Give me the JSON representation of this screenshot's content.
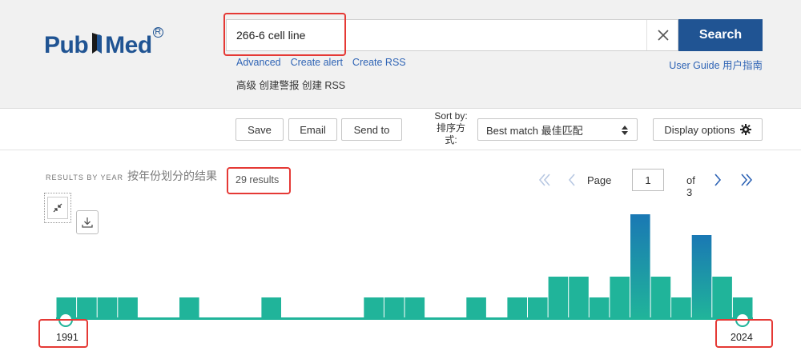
{
  "brand": {
    "logo_pub": "Pub",
    "logo_med": "Med",
    "registered": "R"
  },
  "search": {
    "query": "266-6 cell line",
    "button_label": "Search",
    "links": [
      "Advanced",
      "Create alert",
      "Create RSS"
    ],
    "links_cn": "高级 创建警报 创建 RSS",
    "user_guide": "User Guide 用户指南"
  },
  "toolbar": {
    "save_label": "Save",
    "email_label": "Email",
    "send_label": "Send to",
    "sort_label": "Sort by: 排序方式:",
    "sort_value": "Best match 最佳匹配",
    "display_label": "Display options"
  },
  "results": {
    "rby_small": "RESULTS BY YEAR",
    "rby_cn": "按年份划分的结果",
    "count": "29 results"
  },
  "pagination": {
    "page_label": "Page",
    "current_page": "1",
    "of_label": "of 3"
  },
  "icons": {
    "clear": "close-icon",
    "sort": "sort-arrows-icon",
    "display": "gear-icon",
    "expand": "collapse-arrows-icon",
    "download": "download-icon",
    "first": "double-chevron-left-icon",
    "prev": "chevron-left-icon",
    "next": "chevron-right-icon",
    "last": "double-chevron-right-icon"
  },
  "colors": {
    "brand": "#205493",
    "accent_link": "#2f64b5",
    "bar": "#20b49a",
    "bar_top": "#1a78b4",
    "highlight": "#e53935"
  },
  "chart_data": {
    "type": "bar",
    "title": "",
    "xlabel": "",
    "ylabel": "",
    "start_label": "1991",
    "end_label": "2024",
    "categories": [
      "1991",
      "1992",
      "1993",
      "1994",
      "1995",
      "1996",
      "1997",
      "1998",
      "1999",
      "2000",
      "2001",
      "2002",
      "2003",
      "2004",
      "2005",
      "2006",
      "2007",
      "2008",
      "2009",
      "2010",
      "2011",
      "2012",
      "2013",
      "2014",
      "2015",
      "2016",
      "2017",
      "2018",
      "2019",
      "2020",
      "2021",
      "2022",
      "2023",
      "2024"
    ],
    "values": [
      1,
      1,
      1,
      1,
      0,
      0,
      1,
      0,
      0,
      0,
      1,
      0,
      0,
      0,
      0,
      1,
      1,
      1,
      0,
      0,
      1,
      0,
      1,
      1,
      2,
      2,
      1,
      2,
      5,
      2,
      1,
      4,
      2,
      1
    ],
    "ylim": [
      0,
      5
    ],
    "grid": false
  }
}
